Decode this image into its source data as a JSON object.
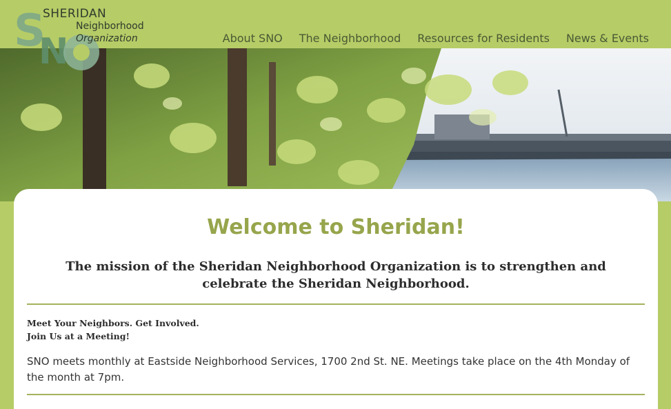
{
  "logo": {
    "letters": "SNO",
    "line1": "SHERIDAN",
    "line2": "Neighborhood",
    "line3": "Organization",
    "colors": {
      "s": "#7ba78a",
      "n": "#5f8f6c",
      "o": "#8db49a"
    }
  },
  "nav": {
    "items": [
      {
        "label": "About SNO"
      },
      {
        "label": "The Neighborhood"
      },
      {
        "label": "Resources for Residents"
      },
      {
        "label": "News & Events"
      }
    ]
  },
  "hero": {
    "icon": "river-trees-photo"
  },
  "main": {
    "title": "Welcome to Sheridan!",
    "mission": "The mission of the Sheridan Neighborhood Organization is to strengthen and celebrate the Sheridan Neighborhood.",
    "subheading_1": "Meet Your Neighbors. Get Involved.",
    "subheading_2": "Join Us at a Meeting!",
    "meeting_text": "SNO meets monthly at Eastside Neighborhood Services, 1700 2nd St. NE. Meetings take place on the 4th Monday of the month at 7pm."
  },
  "colors": {
    "header_bg": "#b6cc67",
    "title": "#97a54c",
    "nav_text": "#4a5a33",
    "rule": "#a4b25d"
  }
}
